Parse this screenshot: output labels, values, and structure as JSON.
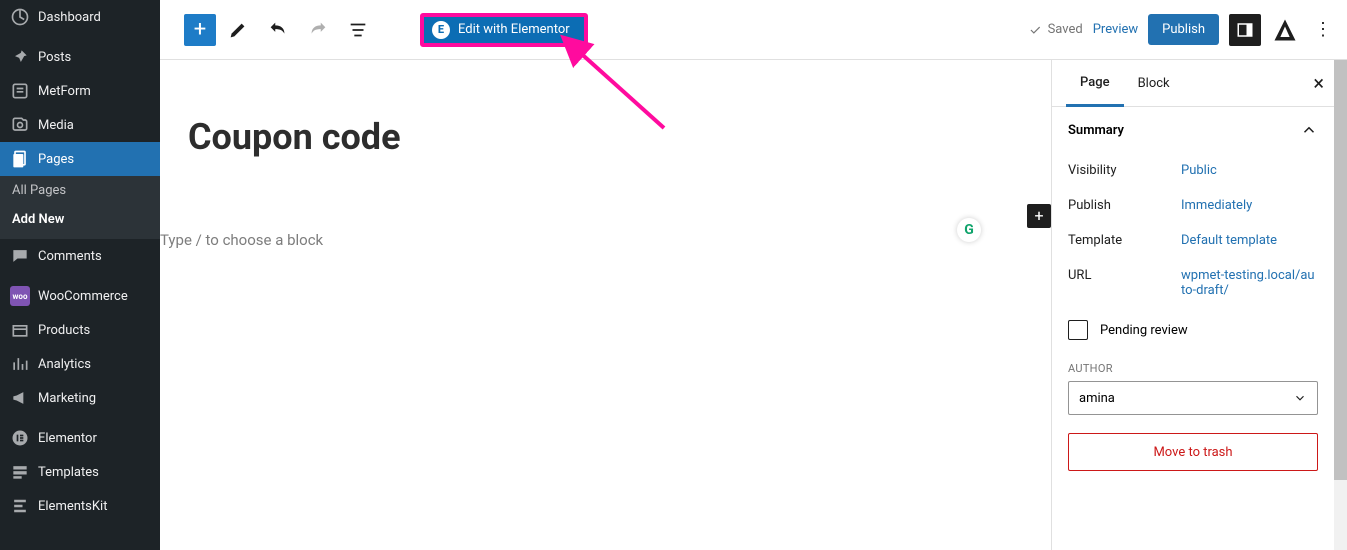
{
  "sidebar": {
    "items": [
      {
        "label": "Dashboard"
      },
      {
        "label": "Posts"
      },
      {
        "label": "MetForm"
      },
      {
        "label": "Media"
      },
      {
        "label": "Pages"
      },
      {
        "label": "Comments"
      },
      {
        "label": "WooCommerce"
      },
      {
        "label": "Products"
      },
      {
        "label": "Analytics"
      },
      {
        "label": "Marketing"
      },
      {
        "label": "Elementor"
      },
      {
        "label": "Templates"
      },
      {
        "label": "ElementsKit"
      }
    ],
    "submenu": {
      "all": "All Pages",
      "add": "Add New"
    }
  },
  "toolbar": {
    "elementor_label": "Edit with Elementor",
    "saved_label": "Saved",
    "preview_label": "Preview",
    "publish_label": "Publish"
  },
  "canvas": {
    "title": "Coupon code",
    "placeholder": "Type / to choose a block"
  },
  "panel": {
    "tabs": {
      "page": "Page",
      "block": "Block"
    },
    "summary": "Summary",
    "visibility_k": "Visibility",
    "visibility_v": "Public",
    "publish_k": "Publish",
    "publish_v": "Immediately",
    "template_k": "Template",
    "template_v": "Default template",
    "url_k": "URL",
    "url_v": "wpmet-testing.local/auto-draft/",
    "pending": "Pending review",
    "author_label": "Author",
    "author_value": "amina",
    "trash": "Move to trash"
  }
}
